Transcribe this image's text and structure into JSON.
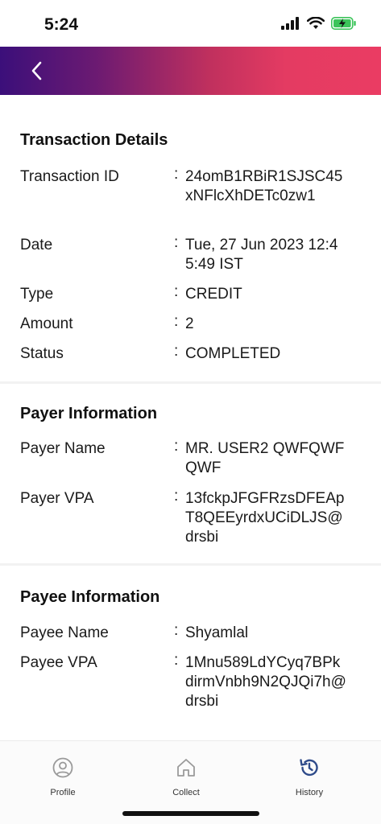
{
  "status_bar": {
    "time": "5:24"
  },
  "header": {
    "back_icon": "chevron-left-icon",
    "gradient_start": "#3b0f7a",
    "gradient_end": "#ea3c63"
  },
  "transaction": {
    "title": "Transaction Details",
    "rows": [
      {
        "label": "Transaction ID",
        "value": "24omB1RBiR1SJSC45xNFlcXhDETc0zw1"
      },
      {
        "label": "Date",
        "value": "Tue, 27 Jun 2023 12:45:49 IST"
      },
      {
        "label": "Type",
        "value": "CREDIT"
      },
      {
        "label": "Amount",
        "value": "2"
      },
      {
        "label": "Status",
        "value": "COMPLETED"
      }
    ]
  },
  "payer": {
    "title": "Payer Information",
    "rows": [
      {
        "label": "Payer Name",
        "value": "MR. USER2 QWFQWFQWF"
      },
      {
        "label": "Payer VPA",
        "value": "13fckpJFGFRzsDFEApT8QEEyrdxUCiDLJS@drsbi"
      }
    ]
  },
  "payee": {
    "title": "Payee Information",
    "rows": [
      {
        "label": "Payee Name",
        "value": "Shyamlal"
      },
      {
        "label": "Payee VPA",
        "value": "1Mnu589LdYCyq7BPkdirmVnbh9N2QJQi7h@drsbi"
      }
    ]
  },
  "colon": ":",
  "tabs": [
    {
      "label": "Profile",
      "icon": "user-circle-icon"
    },
    {
      "label": "Collect",
      "icon": "home-icon"
    },
    {
      "label": "History",
      "icon": "history-icon",
      "active": true
    }
  ],
  "colors": {
    "active_tab": "#2f4b8a",
    "inactive_tab": "#9a9a9a"
  }
}
